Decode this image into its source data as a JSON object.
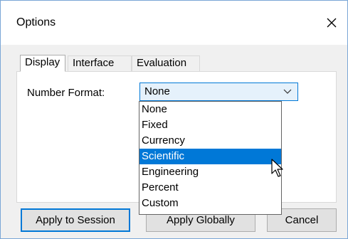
{
  "window": {
    "title": "Options"
  },
  "tabs": [
    {
      "label": "Display",
      "active": true
    },
    {
      "label": "Interface",
      "active": false
    },
    {
      "label": "Evaluation",
      "active": false
    }
  ],
  "display": {
    "number_format_label": "Number Format:",
    "number_format_value": "None",
    "options": [
      "None",
      "Fixed",
      "Currency",
      "Scientific",
      "Engineering",
      "Percent",
      "Custom"
    ],
    "highlighted_option": "Scientific"
  },
  "buttons": {
    "apply_session": "Apply to Session",
    "apply_globally": "Apply Globally",
    "cancel": "Cancel"
  },
  "icons": {
    "close": "close-icon",
    "dropdown": "chevron-down-icon",
    "cursor": "mouse-pointer-icon"
  },
  "colors": {
    "accent": "#0078d7",
    "selection_bg": "#0078d7",
    "combo_bg": "#e5f1fb",
    "dialog_bg": "#f0f0f0"
  }
}
